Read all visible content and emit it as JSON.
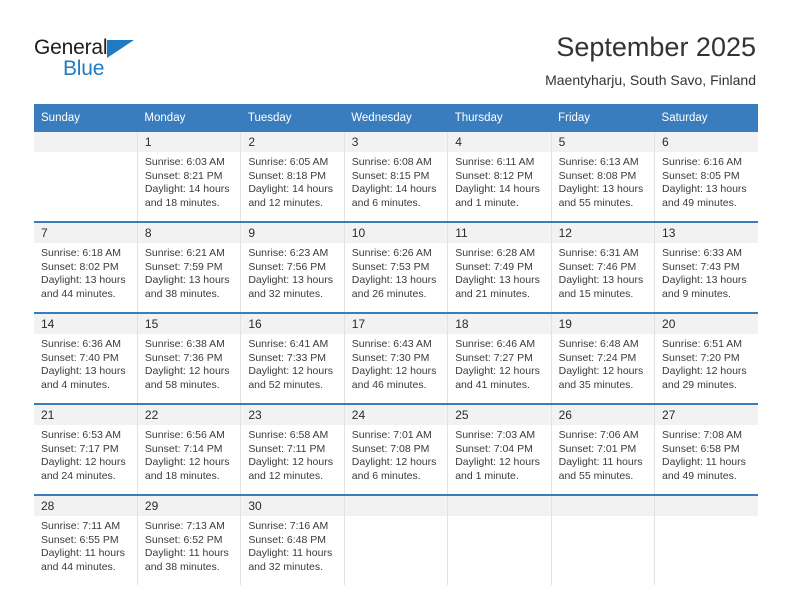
{
  "brand": {
    "name_part1": "General",
    "name_part2": "Blue",
    "triangle_color": "#1f7cc4"
  },
  "header": {
    "title": "September 2025",
    "subtitle": "Maentyharju, South Savo, Finland"
  },
  "theme": {
    "header_blue": "#3a7dbf",
    "daynum_band": "#f2f2f2",
    "cell_border": "#e2e2e2"
  },
  "weekdays": [
    "Sunday",
    "Monday",
    "Tuesday",
    "Wednesday",
    "Thursday",
    "Friday",
    "Saturday"
  ],
  "labels": {
    "sunrise_prefix": "Sunrise:",
    "sunset_prefix": "Sunset:",
    "daylight_prefix": "Daylight:"
  },
  "weeks": [
    [
      {
        "day": "",
        "sunrise": "",
        "sunset": "",
        "daylight_1": "",
        "daylight_2": ""
      },
      {
        "day": "1",
        "sunrise": "Sunrise: 6:03 AM",
        "sunset": "Sunset: 8:21 PM",
        "daylight_1": "Daylight: 14 hours",
        "daylight_2": "and 18 minutes."
      },
      {
        "day": "2",
        "sunrise": "Sunrise: 6:05 AM",
        "sunset": "Sunset: 8:18 PM",
        "daylight_1": "Daylight: 14 hours",
        "daylight_2": "and 12 minutes."
      },
      {
        "day": "3",
        "sunrise": "Sunrise: 6:08 AM",
        "sunset": "Sunset: 8:15 PM",
        "daylight_1": "Daylight: 14 hours",
        "daylight_2": "and 6 minutes."
      },
      {
        "day": "4",
        "sunrise": "Sunrise: 6:11 AM",
        "sunset": "Sunset: 8:12 PM",
        "daylight_1": "Daylight: 14 hours",
        "daylight_2": "and 1 minute."
      },
      {
        "day": "5",
        "sunrise": "Sunrise: 6:13 AM",
        "sunset": "Sunset: 8:08 PM",
        "daylight_1": "Daylight: 13 hours",
        "daylight_2": "and 55 minutes."
      },
      {
        "day": "6",
        "sunrise": "Sunrise: 6:16 AM",
        "sunset": "Sunset: 8:05 PM",
        "daylight_1": "Daylight: 13 hours",
        "daylight_2": "and 49 minutes."
      }
    ],
    [
      {
        "day": "7",
        "sunrise": "Sunrise: 6:18 AM",
        "sunset": "Sunset: 8:02 PM",
        "daylight_1": "Daylight: 13 hours",
        "daylight_2": "and 44 minutes."
      },
      {
        "day": "8",
        "sunrise": "Sunrise: 6:21 AM",
        "sunset": "Sunset: 7:59 PM",
        "daylight_1": "Daylight: 13 hours",
        "daylight_2": "and 38 minutes."
      },
      {
        "day": "9",
        "sunrise": "Sunrise: 6:23 AM",
        "sunset": "Sunset: 7:56 PM",
        "daylight_1": "Daylight: 13 hours",
        "daylight_2": "and 32 minutes."
      },
      {
        "day": "10",
        "sunrise": "Sunrise: 6:26 AM",
        "sunset": "Sunset: 7:53 PM",
        "daylight_1": "Daylight: 13 hours",
        "daylight_2": "and 26 minutes."
      },
      {
        "day": "11",
        "sunrise": "Sunrise: 6:28 AM",
        "sunset": "Sunset: 7:49 PM",
        "daylight_1": "Daylight: 13 hours",
        "daylight_2": "and 21 minutes."
      },
      {
        "day": "12",
        "sunrise": "Sunrise: 6:31 AM",
        "sunset": "Sunset: 7:46 PM",
        "daylight_1": "Daylight: 13 hours",
        "daylight_2": "and 15 minutes."
      },
      {
        "day": "13",
        "sunrise": "Sunrise: 6:33 AM",
        "sunset": "Sunset: 7:43 PM",
        "daylight_1": "Daylight: 13 hours",
        "daylight_2": "and 9 minutes."
      }
    ],
    [
      {
        "day": "14",
        "sunrise": "Sunrise: 6:36 AM",
        "sunset": "Sunset: 7:40 PM",
        "daylight_1": "Daylight: 13 hours",
        "daylight_2": "and 4 minutes."
      },
      {
        "day": "15",
        "sunrise": "Sunrise: 6:38 AM",
        "sunset": "Sunset: 7:36 PM",
        "daylight_1": "Daylight: 12 hours",
        "daylight_2": "and 58 minutes."
      },
      {
        "day": "16",
        "sunrise": "Sunrise: 6:41 AM",
        "sunset": "Sunset: 7:33 PM",
        "daylight_1": "Daylight: 12 hours",
        "daylight_2": "and 52 minutes."
      },
      {
        "day": "17",
        "sunrise": "Sunrise: 6:43 AM",
        "sunset": "Sunset: 7:30 PM",
        "daylight_1": "Daylight: 12 hours",
        "daylight_2": "and 46 minutes."
      },
      {
        "day": "18",
        "sunrise": "Sunrise: 6:46 AM",
        "sunset": "Sunset: 7:27 PM",
        "daylight_1": "Daylight: 12 hours",
        "daylight_2": "and 41 minutes."
      },
      {
        "day": "19",
        "sunrise": "Sunrise: 6:48 AM",
        "sunset": "Sunset: 7:24 PM",
        "daylight_1": "Daylight: 12 hours",
        "daylight_2": "and 35 minutes."
      },
      {
        "day": "20",
        "sunrise": "Sunrise: 6:51 AM",
        "sunset": "Sunset: 7:20 PM",
        "daylight_1": "Daylight: 12 hours",
        "daylight_2": "and 29 minutes."
      }
    ],
    [
      {
        "day": "21",
        "sunrise": "Sunrise: 6:53 AM",
        "sunset": "Sunset: 7:17 PM",
        "daylight_1": "Daylight: 12 hours",
        "daylight_2": "and 24 minutes."
      },
      {
        "day": "22",
        "sunrise": "Sunrise: 6:56 AM",
        "sunset": "Sunset: 7:14 PM",
        "daylight_1": "Daylight: 12 hours",
        "daylight_2": "and 18 minutes."
      },
      {
        "day": "23",
        "sunrise": "Sunrise: 6:58 AM",
        "sunset": "Sunset: 7:11 PM",
        "daylight_1": "Daylight: 12 hours",
        "daylight_2": "and 12 minutes."
      },
      {
        "day": "24",
        "sunrise": "Sunrise: 7:01 AM",
        "sunset": "Sunset: 7:08 PM",
        "daylight_1": "Daylight: 12 hours",
        "daylight_2": "and 6 minutes."
      },
      {
        "day": "25",
        "sunrise": "Sunrise: 7:03 AM",
        "sunset": "Sunset: 7:04 PM",
        "daylight_1": "Daylight: 12 hours",
        "daylight_2": "and 1 minute."
      },
      {
        "day": "26",
        "sunrise": "Sunrise: 7:06 AM",
        "sunset": "Sunset: 7:01 PM",
        "daylight_1": "Daylight: 11 hours",
        "daylight_2": "and 55 minutes."
      },
      {
        "day": "27",
        "sunrise": "Sunrise: 7:08 AM",
        "sunset": "Sunset: 6:58 PM",
        "daylight_1": "Daylight: 11 hours",
        "daylight_2": "and 49 minutes."
      }
    ],
    [
      {
        "day": "28",
        "sunrise": "Sunrise: 7:11 AM",
        "sunset": "Sunset: 6:55 PM",
        "daylight_1": "Daylight: 11 hours",
        "daylight_2": "and 44 minutes."
      },
      {
        "day": "29",
        "sunrise": "Sunrise: 7:13 AM",
        "sunset": "Sunset: 6:52 PM",
        "daylight_1": "Daylight: 11 hours",
        "daylight_2": "and 38 minutes."
      },
      {
        "day": "30",
        "sunrise": "Sunrise: 7:16 AM",
        "sunset": "Sunset: 6:48 PM",
        "daylight_1": "Daylight: 11 hours",
        "daylight_2": "and 32 minutes."
      },
      {
        "day": "",
        "sunrise": "",
        "sunset": "",
        "daylight_1": "",
        "daylight_2": ""
      },
      {
        "day": "",
        "sunrise": "",
        "sunset": "",
        "daylight_1": "",
        "daylight_2": ""
      },
      {
        "day": "",
        "sunrise": "",
        "sunset": "",
        "daylight_1": "",
        "daylight_2": ""
      },
      {
        "day": "",
        "sunrise": "",
        "sunset": "",
        "daylight_1": "",
        "daylight_2": ""
      }
    ]
  ]
}
